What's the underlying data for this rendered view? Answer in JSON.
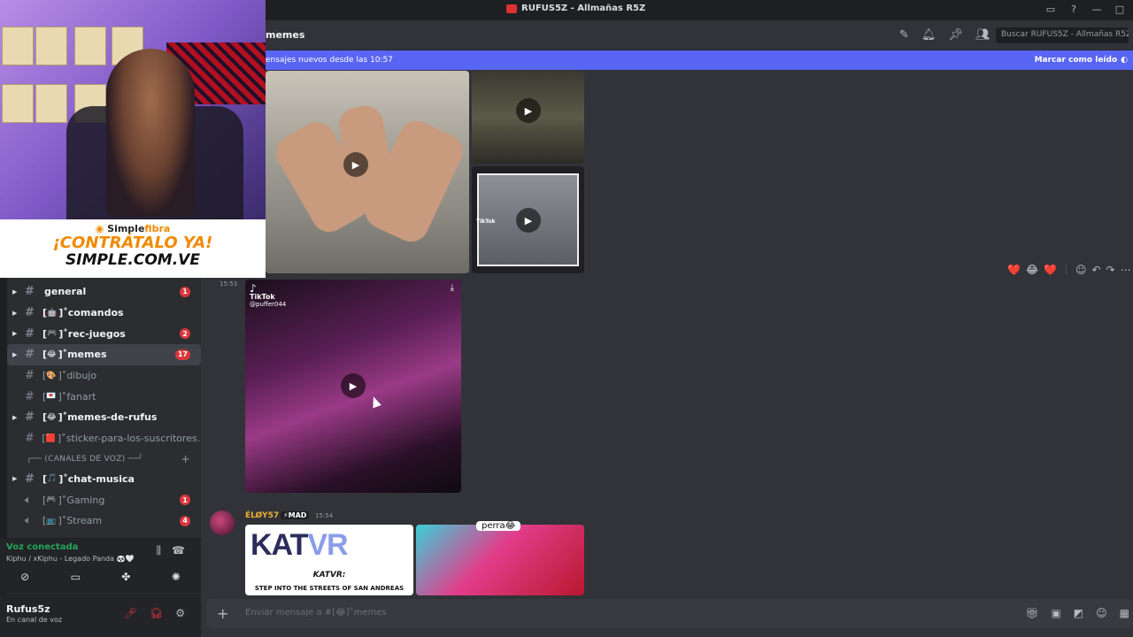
{
  "window": {
    "title": "RUFUS5Z - Allmañas R5Z"
  },
  "header": {
    "channel": "memes",
    "search_placeholder": "Buscar RUFUS5Z - Allmañas R5Z"
  },
  "new_messages_bar": {
    "text": "ensajes nuevos desde las 10:57",
    "mark_read": "Marcar como leído"
  },
  "ad": {
    "brand_a": "Simple",
    "brand_b": "fibra",
    "line1": "¡CONTRÁTALO YA!",
    "line2": "SIMPLE.COM.VE"
  },
  "channels": [
    {
      "name": "general",
      "emoji": "",
      "prefix": "",
      "badge": "1",
      "state": "unread",
      "arrow": true
    },
    {
      "name": "comandos",
      "emoji": "🤖",
      "prefix": "[",
      "badge": "",
      "state": "unread",
      "arrow": true
    },
    {
      "name": "rec-juegos",
      "emoji": "🎮",
      "prefix": "[",
      "badge": "2",
      "state": "unread",
      "arrow": true
    },
    {
      "name": "memes",
      "emoji": "😂",
      "prefix": "[",
      "badge": "17",
      "state": "active",
      "arrow": true
    },
    {
      "name": "dibujo",
      "emoji": "🎨",
      "prefix": "[",
      "badge": "",
      "state": "read",
      "arrow": false
    },
    {
      "name": "fanart",
      "emoji": "💌",
      "prefix": "[",
      "badge": "",
      "state": "read",
      "arrow": false
    },
    {
      "name": "memes-de-rufus",
      "emoji": "😂",
      "prefix": "[",
      "badge": "",
      "state": "unread",
      "arrow": true
    },
    {
      "name": "sticker-para-los-suscritores...",
      "emoji": "🟥",
      "prefix": "",
      "badge": "",
      "state": "read",
      "arrow": false
    }
  ],
  "voice_category": "╭── (CANALES DE VOZ) ──╯",
  "voice_channels": [
    {
      "name": "chat-musica",
      "emoji": "🎵",
      "badge": "",
      "state": "unread",
      "arrow": true,
      "kind": "text"
    },
    {
      "name": "Gaming",
      "emoji": "🎮",
      "badge": "1",
      "state": "read",
      "arrow": false,
      "kind": "voice"
    },
    {
      "name": "Stream",
      "emoji": "📺",
      "badge": "4",
      "state": "read",
      "arrow": false,
      "kind": "voice"
    }
  ],
  "voice_panel": {
    "status": "Voz conectada",
    "channel": "Kiphu / xKiphu - Legado Panda 🐼🤍"
  },
  "user_panel": {
    "name": "Rufus5z",
    "status": "En canal de voz"
  },
  "messages": {
    "time1": "15:53",
    "tiktok_label": "TikTok",
    "tiktok_user": "@puffer044",
    "tiktok_label_small": "TikTok",
    "author2": "ÉLØY57",
    "author2_tag": "⚡MAD",
    "time2": "15:54",
    "kat_title": "KAT",
    "kat_vr": "VR",
    "kat_line": "KATVR:",
    "kat_sub": "STEP INTO THE STREETS OF SAN ANDREAS",
    "caption": "perra😂"
  },
  "reactions": [
    "❤️",
    "😂",
    "❤️"
  ],
  "composer": {
    "placeholder": "Enviar mensaje a #[😂]˚memes"
  }
}
